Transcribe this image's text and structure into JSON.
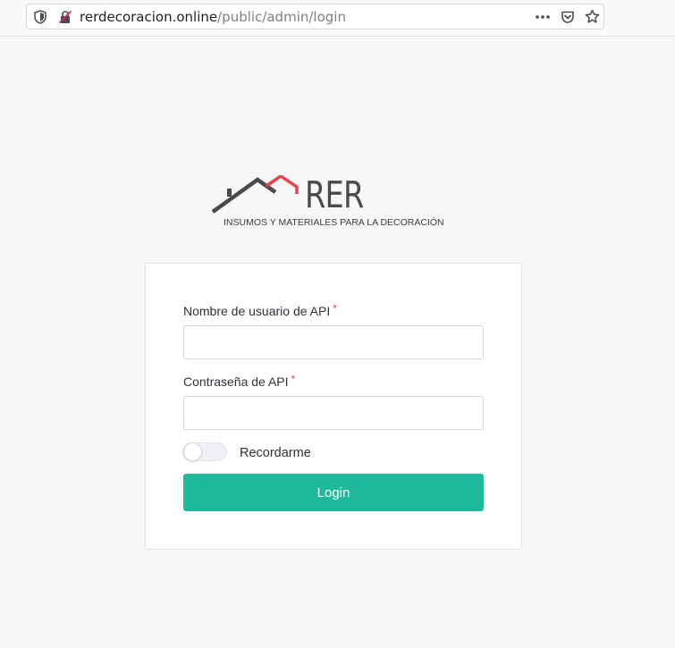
{
  "browser": {
    "url_host": "rerdecoracion.online",
    "url_path": "/public/admin/login",
    "icons": {
      "shield": "shield-icon",
      "insecure": "insecure-connection-icon",
      "more": "more-actions-icon",
      "pocket": "pocket-icon",
      "bookmark": "star-icon"
    }
  },
  "logo": {
    "brand": "RER",
    "tagline": "INSUMOS Y MATERIALES PARA LA DECORACIÓN",
    "colors": {
      "roof_dark": "#4a4a4d",
      "roof_accent": "#e8434b"
    }
  },
  "form": {
    "username": {
      "label": "Nombre de usuario de API",
      "required_mark": "*",
      "value": "",
      "placeholder": ""
    },
    "password": {
      "label": "Contraseña de API",
      "required_mark": "*",
      "value": "",
      "placeholder": ""
    },
    "remember": {
      "label": "Recordarme",
      "checked": false
    },
    "submit_label": "Login"
  },
  "colors": {
    "accent": "#1fba9b",
    "required": "#e43d4d",
    "page_background": "#f7f7f9"
  }
}
